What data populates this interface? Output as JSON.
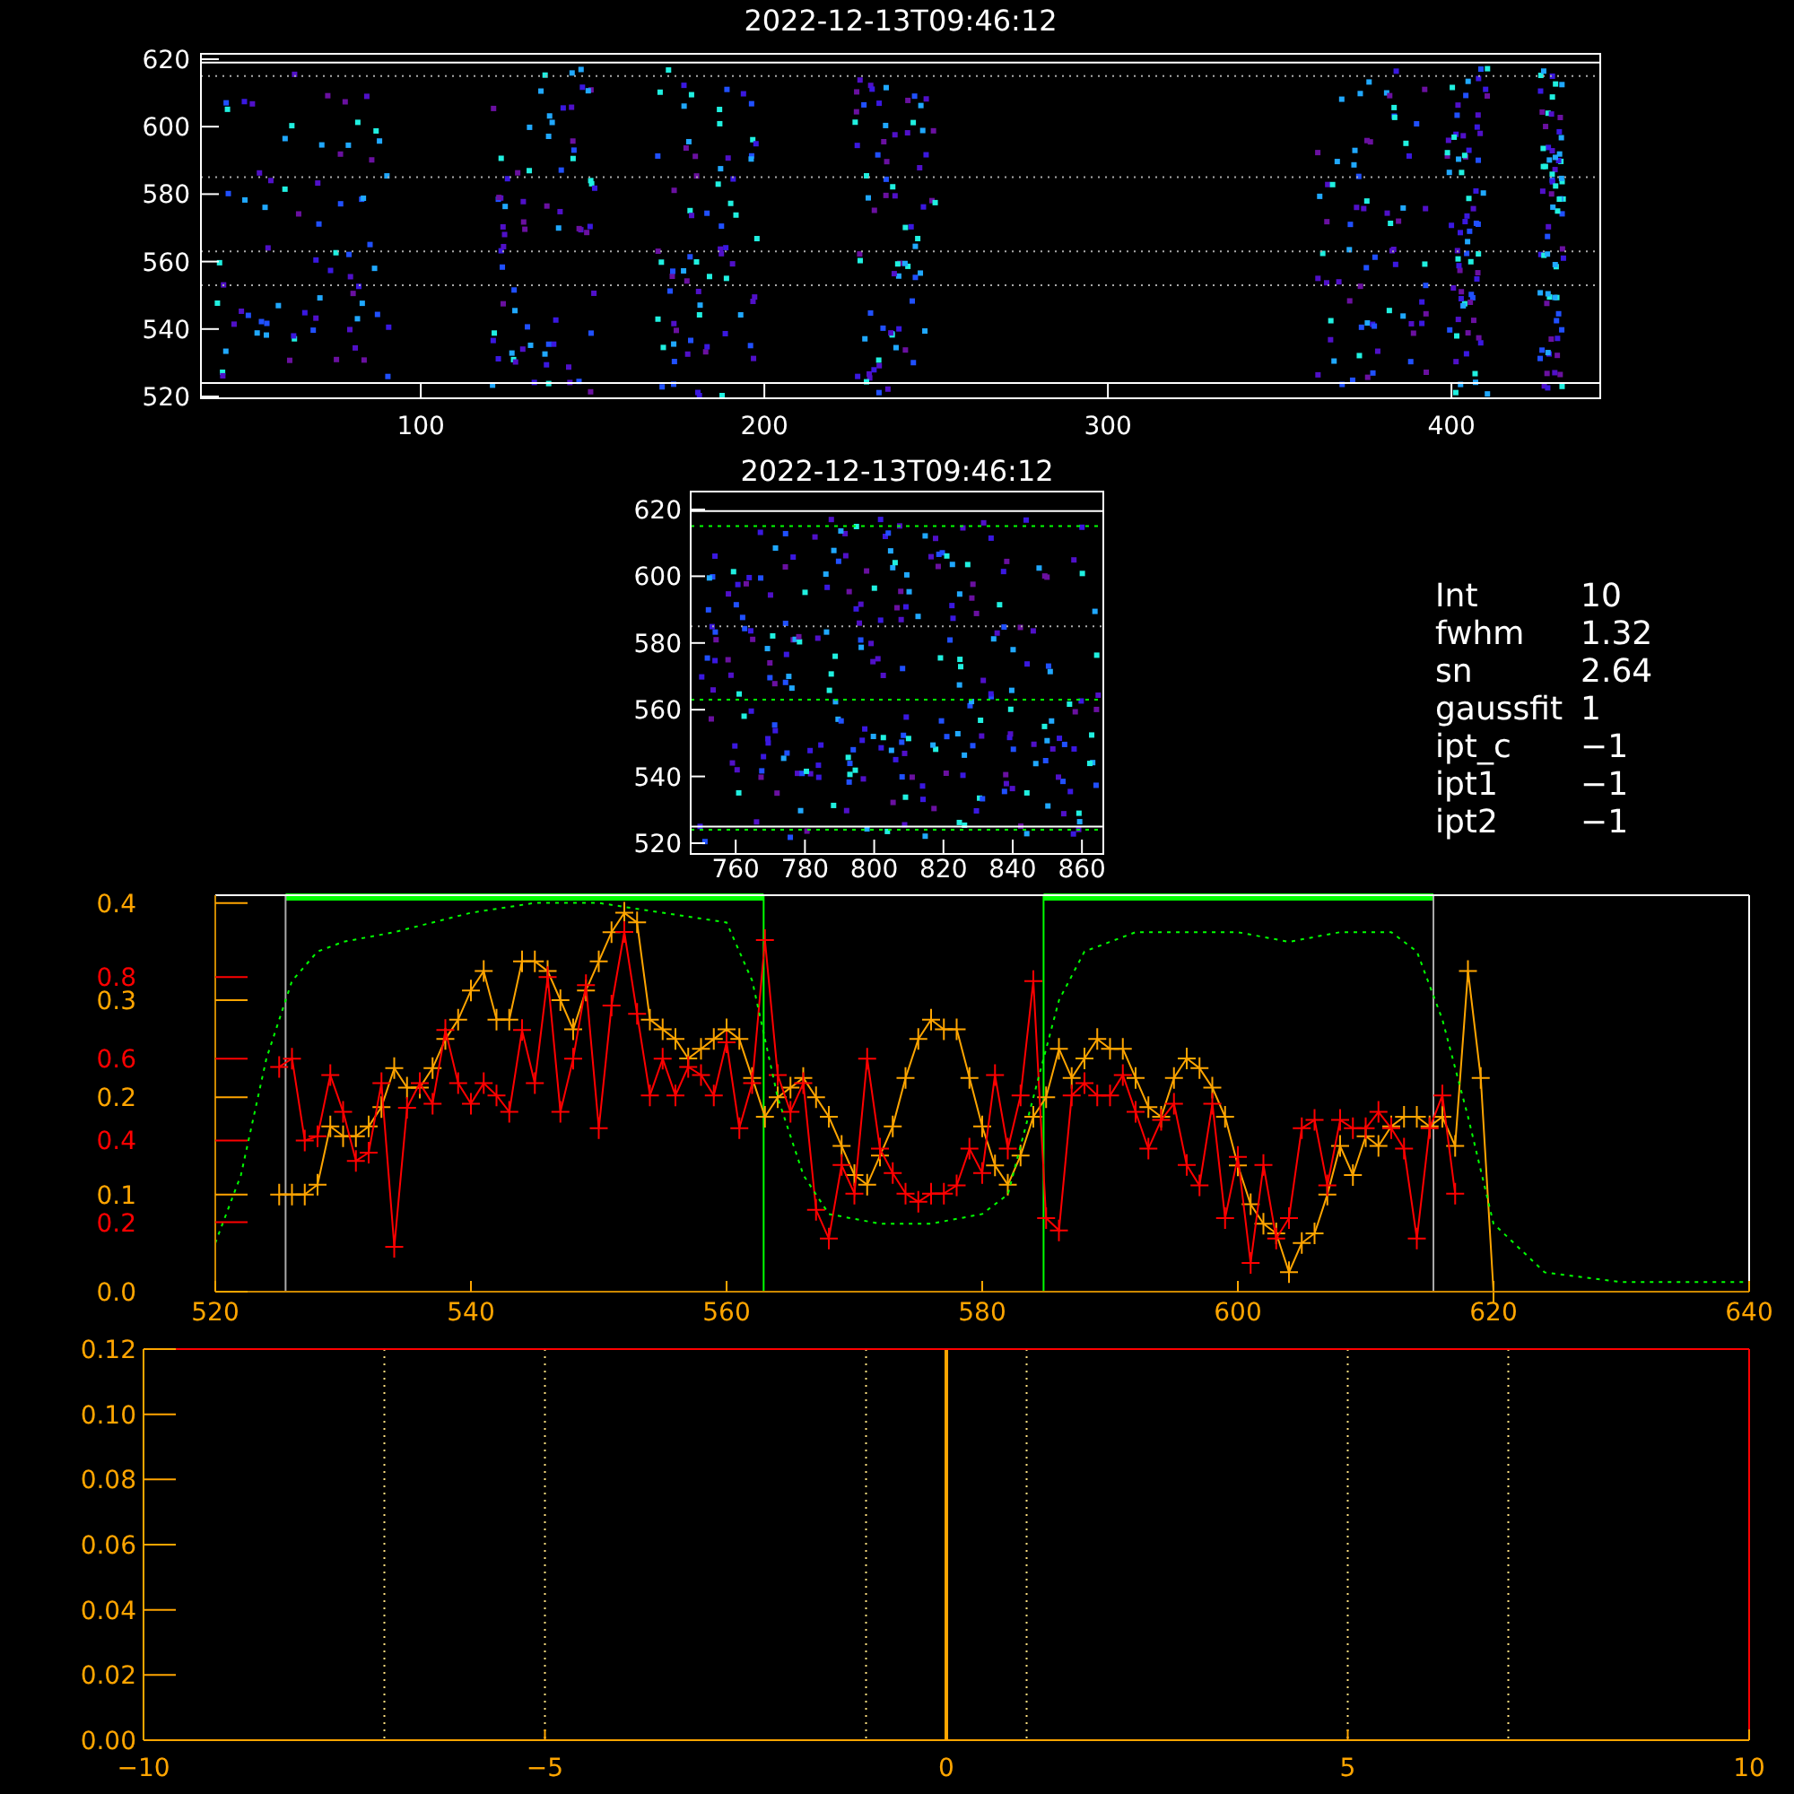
{
  "image_panel": {
    "title": "2022-12-13T09:46:12",
    "xticks": [
      "100",
      "200",
      "300",
      "400"
    ],
    "yticks": [
      "620",
      "600",
      "580",
      "560",
      "540",
      "520"
    ]
  },
  "zoom_panel": {
    "title": "2022-12-13T09:46:12",
    "xticks": [
      "760",
      "780",
      "800",
      "820",
      "840",
      "860"
    ],
    "yticks": [
      "620",
      "600",
      "580",
      "560",
      "540",
      "520"
    ]
  },
  "fit_info": [
    {
      "label": "Int",
      "value": "10"
    },
    {
      "label": "fwhm",
      "value": "1.32"
    },
    {
      "label": "sn",
      "value": "2.64"
    },
    {
      "label": "gaussfit",
      "value": "1"
    },
    {
      "label": "ipt_c",
      "value": "−1"
    },
    {
      "label": "ipt1",
      "value": "−1"
    },
    {
      "label": "ipt2",
      "value": "−1"
    }
  ],
  "profile_plot": {
    "chart_data": {
      "type": "line",
      "xlim": [
        520,
        640
      ],
      "ylim": [
        0,
        0.408
      ],
      "y2lim": [
        0.03,
        1.0
      ],
      "xticks": [
        {
          "value": 520,
          "label": "520"
        },
        {
          "value": 540,
          "label": "540"
        },
        {
          "value": 560,
          "label": "560"
        },
        {
          "value": 580,
          "label": "580"
        },
        {
          "value": 600,
          "label": "600"
        },
        {
          "value": 620,
          "label": "620"
        },
        {
          "value": 640,
          "label": "640"
        }
      ],
      "yticks": [
        {
          "value": 0,
          "label": "0.0"
        },
        {
          "value": 0.1,
          "label": "0.1"
        },
        {
          "value": 0.2,
          "label": "0.2"
        },
        {
          "value": 0.3,
          "label": "0.3"
        },
        {
          "value": 0.4,
          "label": "0.4"
        }
      ],
      "y2ticks": [
        {
          "value": 0.2,
          "label": "0.2"
        },
        {
          "value": 0.4,
          "label": "0.4"
        },
        {
          "value": 0.6,
          "label": "0.6"
        },
        {
          "value": 0.8,
          "label": "0.8"
        }
      ],
      "series": [
        {
          "color": "#ffa500",
          "marker": "+",
          "x": [
            525,
            526,
            527,
            528,
            529,
            530,
            531,
            532,
            533,
            534,
            535,
            536,
            537,
            538,
            539,
            540,
            541,
            542,
            543,
            544,
            545,
            546,
            547,
            548,
            549,
            550,
            551,
            552,
            553,
            554,
            555,
            556,
            557,
            558,
            559,
            560,
            561,
            562,
            563,
            564,
            565,
            566,
            567,
            568,
            569,
            570,
            571,
            572,
            573,
            574,
            575,
            576,
            577,
            578,
            579,
            580,
            581,
            582,
            583,
            584,
            585,
            586,
            587,
            588,
            589,
            590,
            591,
            592,
            593,
            594,
            595,
            596,
            597,
            598,
            599,
            600,
            601,
            602,
            603,
            604,
            605,
            606,
            607,
            608,
            609,
            610,
            611,
            612,
            613,
            614,
            615,
            616,
            617,
            618,
            619,
            620
          ],
          "values": [
            0.1,
            0.1,
            0.1,
            0.11,
            0.17,
            0.16,
            0.16,
            0.17,
            0.19,
            0.23,
            0.21,
            0.21,
            0.23,
            0.26,
            0.28,
            0.31,
            0.33,
            0.28,
            0.28,
            0.34,
            0.34,
            0.33,
            0.3,
            0.27,
            0.31,
            0.34,
            0.37,
            0.39,
            0.38,
            0.28,
            0.27,
            0.26,
            0.24,
            0.25,
            0.26,
            0.27,
            0.26,
            0.22,
            0.18,
            0.2,
            0.21,
            0.22,
            0.2,
            0.18,
            0.15,
            0.12,
            0.11,
            0.14,
            0.17,
            0.22,
            0.26,
            0.28,
            0.27,
            0.27,
            0.22,
            0.17,
            0.13,
            0.11,
            0.14,
            0.18,
            0.2,
            0.25,
            0.22,
            0.24,
            0.26,
            0.25,
            0.25,
            0.22,
            0.19,
            0.18,
            0.22,
            0.24,
            0.23,
            0.21,
            0.18,
            0.13,
            0.09,
            0.07,
            0.06,
            0.02,
            0.05,
            0.06,
            0.1,
            0.15,
            0.12,
            0.16,
            0.15,
            0.17,
            0.18,
            0.18,
            0.17,
            0.18,
            0.15,
            0.33,
            0.22,
            0.0
          ]
        },
        {
          "color": "#ff0000",
          "axis": "y2",
          "marker": "+",
          "x": [
            525,
            526,
            527,
            528,
            529,
            530,
            531,
            532,
            533,
            534,
            535,
            536,
            537,
            538,
            539,
            540,
            541,
            542,
            543,
            544,
            545,
            546,
            547,
            548,
            549,
            550,
            551,
            552,
            553,
            554,
            555,
            556,
            557,
            558,
            559,
            560,
            561,
            562,
            563,
            564,
            565,
            566,
            567,
            568,
            569,
            570,
            571,
            572,
            573,
            574,
            575,
            576,
            577,
            578,
            579,
            580,
            581,
            582,
            583,
            584,
            585,
            586,
            587,
            588,
            589,
            590,
            591,
            592,
            593,
            594,
            595,
            596,
            597,
            598,
            599,
            600,
            601,
            602,
            603,
            604,
            605,
            606,
            607,
            608,
            609,
            610,
            611,
            612,
            613,
            614,
            615,
            616,
            617
          ],
          "values": [
            0.58,
            0.6,
            0.4,
            0.41,
            0.56,
            0.47,
            0.35,
            0.37,
            0.54,
            0.14,
            0.48,
            0.54,
            0.49,
            0.67,
            0.54,
            0.49,
            0.54,
            0.51,
            0.47,
            0.67,
            0.54,
            0.8,
            0.47,
            0.6,
            0.78,
            0.43,
            0.73,
            0.91,
            0.71,
            0.51,
            0.6,
            0.51,
            0.58,
            0.56,
            0.51,
            0.64,
            0.43,
            0.54,
            0.89,
            0.56,
            0.47,
            0.54,
            0.23,
            0.16,
            0.34,
            0.27,
            0.6,
            0.38,
            0.32,
            0.27,
            0.25,
            0.27,
            0.27,
            0.29,
            0.38,
            0.32,
            0.56,
            0.38,
            0.51,
            0.79,
            0.21,
            0.18,
            0.51,
            0.54,
            0.51,
            0.51,
            0.56,
            0.47,
            0.38,
            0.45,
            0.49,
            0.34,
            0.29,
            0.49,
            0.21,
            0.36,
            0.1,
            0.34,
            0.16,
            0.21,
            0.43,
            0.45,
            0.29,
            0.45,
            0.43,
            0.43,
            0.47,
            0.43,
            0.38,
            0.16,
            0.43,
            0.51,
            0.27
          ]
        },
        {
          "color": "#00ff00",
          "line_style": "dotted",
          "x": [
            520,
            522,
            524,
            526,
            528,
            530,
            534,
            540,
            545,
            550,
            555,
            560,
            562,
            564,
            566,
            568,
            572,
            576,
            580,
            582,
            584,
            586,
            588,
            592,
            596,
            600,
            604,
            608,
            612,
            614,
            616,
            618,
            620,
            624,
            630,
            640
          ],
          "values": [
            0.05,
            0.12,
            0.24,
            0.32,
            0.35,
            0.36,
            0.37,
            0.39,
            0.4,
            0.4,
            0.39,
            0.38,
            0.32,
            0.2,
            0.12,
            0.08,
            0.07,
            0.07,
            0.08,
            0.1,
            0.2,
            0.3,
            0.35,
            0.37,
            0.37,
            0.37,
            0.36,
            0.37,
            0.37,
            0.35,
            0.28,
            0.18,
            0.07,
            0.02,
            0.01,
            0.01
          ]
        }
      ],
      "ref_lines": [
        {
          "axis": "x",
          "value": 525.5,
          "color": "#aaaaaa"
        },
        {
          "axis": "x",
          "value": 562.9,
          "color": "#00ff00"
        },
        {
          "axis": "x",
          "value": 584.8,
          "color": "#00ff00"
        },
        {
          "axis": "x",
          "value": 615.3,
          "color": "#aaaaaa"
        }
      ]
    }
  },
  "spectrum_plot": {
    "chart_data": {
      "type": "line",
      "xlim": [
        -10,
        10
      ],
      "ylim": [
        0,
        0.12
      ],
      "xticks": [
        {
          "value": -10,
          "label": "−10"
        },
        {
          "value": -5,
          "label": "−5"
        },
        {
          "value": 0,
          "label": "0"
        },
        {
          "value": 5,
          "label": "5"
        },
        {
          "value": 10,
          "label": "10"
        }
      ],
      "yticks": [
        {
          "value": 0,
          "label": "0.00"
        },
        {
          "value": 0.02,
          "label": "0.02"
        },
        {
          "value": 0.04,
          "label": "0.04"
        },
        {
          "value": 0.06,
          "label": "0.06"
        },
        {
          "value": 0.08,
          "label": "0.08"
        },
        {
          "value": 0.1,
          "label": "0.10"
        },
        {
          "value": 0.12,
          "label": "0.12"
        }
      ],
      "ref_lines": [
        {
          "axis": "x",
          "value": 0,
          "color": "#ffa500"
        },
        {
          "axis": "x",
          "value": -7,
          "color": "#ffe080"
        },
        {
          "axis": "x",
          "value": -5,
          "color": "#ffe080"
        },
        {
          "axis": "x",
          "value": -1,
          "color": "#ffe080"
        },
        {
          "axis": "x",
          "value": 1,
          "color": "#ffe080"
        },
        {
          "axis": "x",
          "value": 5,
          "color": "#ffe080"
        },
        {
          "axis": "x",
          "value": 7,
          "color": "#ffe080"
        }
      ]
    }
  }
}
